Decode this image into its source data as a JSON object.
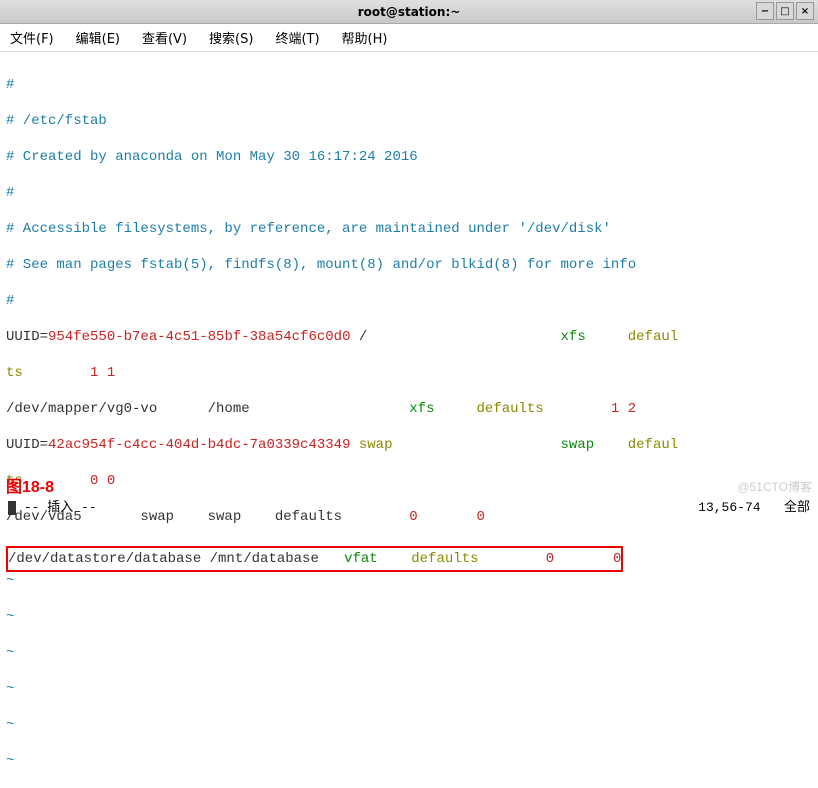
{
  "window": {
    "title": "root@station:~"
  },
  "window_controls": {
    "min": "−",
    "max": "□",
    "close": "×"
  },
  "menu": {
    "file": "文件(F)",
    "edit": "编辑(E)",
    "view": "查看(V)",
    "search": "搜索(S)",
    "term": "终端(T)",
    "help": "帮助(H)"
  },
  "fstab": {
    "c1": "#",
    "c2": "# /etc/fstab",
    "c3": "# Created by anaconda on Mon May 30 16:17:24 2016",
    "c4": "#",
    "c5": "# Accessible filesystems, by reference, are maintained under '/dev/disk'",
    "c6": "# See man pages fstab(5), findfs(8), mount(8) and/or blkid(8) for more info",
    "c7": "#",
    "l1": {
      "pre": "UUID=",
      "uuid": "954fe550-b7ea-4c51-85bf-38a54cf6c0d0",
      "mnt": " /                       ",
      "fs": "xfs",
      "sp1": "     ",
      "opt": "defaul"
    },
    "l1w": {
      "a": "ts",
      "b": "        1 1"
    },
    "l2": {
      "dev": "/dev/mapper/vg0-vo      /home                   ",
      "fs": "xfs",
      "sp": "     ",
      "opt": "defaults",
      "d1": "        1 2"
    },
    "l3": {
      "pre": "UUID=",
      "uuid": "42ac954f-c4cc-404d-b4dc-7a0339c43349",
      "mnt": " ",
      "sw": "swap",
      "sp": "                    ",
      "fs": "swap",
      "sp2": "    ",
      "opt": "defaul"
    },
    "l3w": {
      "a": "ts",
      "b": "        0 0"
    },
    "l4": {
      "dev": "/dev/vda5       swap    swap    defaults        ",
      "d0a": "0",
      "sp": "       ",
      "d0b": "0"
    },
    "hl": {
      "dev": "/dev/datastore/database /mnt/database   ",
      "fs": "vfat",
      "sp": "    ",
      "opt": "defaults",
      "sp2": "        ",
      "d0a": "0",
      "sp3": "       ",
      "d0b": "0"
    }
  },
  "tilde": "~",
  "figure_label": "图18-8",
  "status": {
    "mode": "-- 插入 --",
    "pos": "13,56-74",
    "pct": "全部"
  },
  "watermark": "@51CTO博客"
}
